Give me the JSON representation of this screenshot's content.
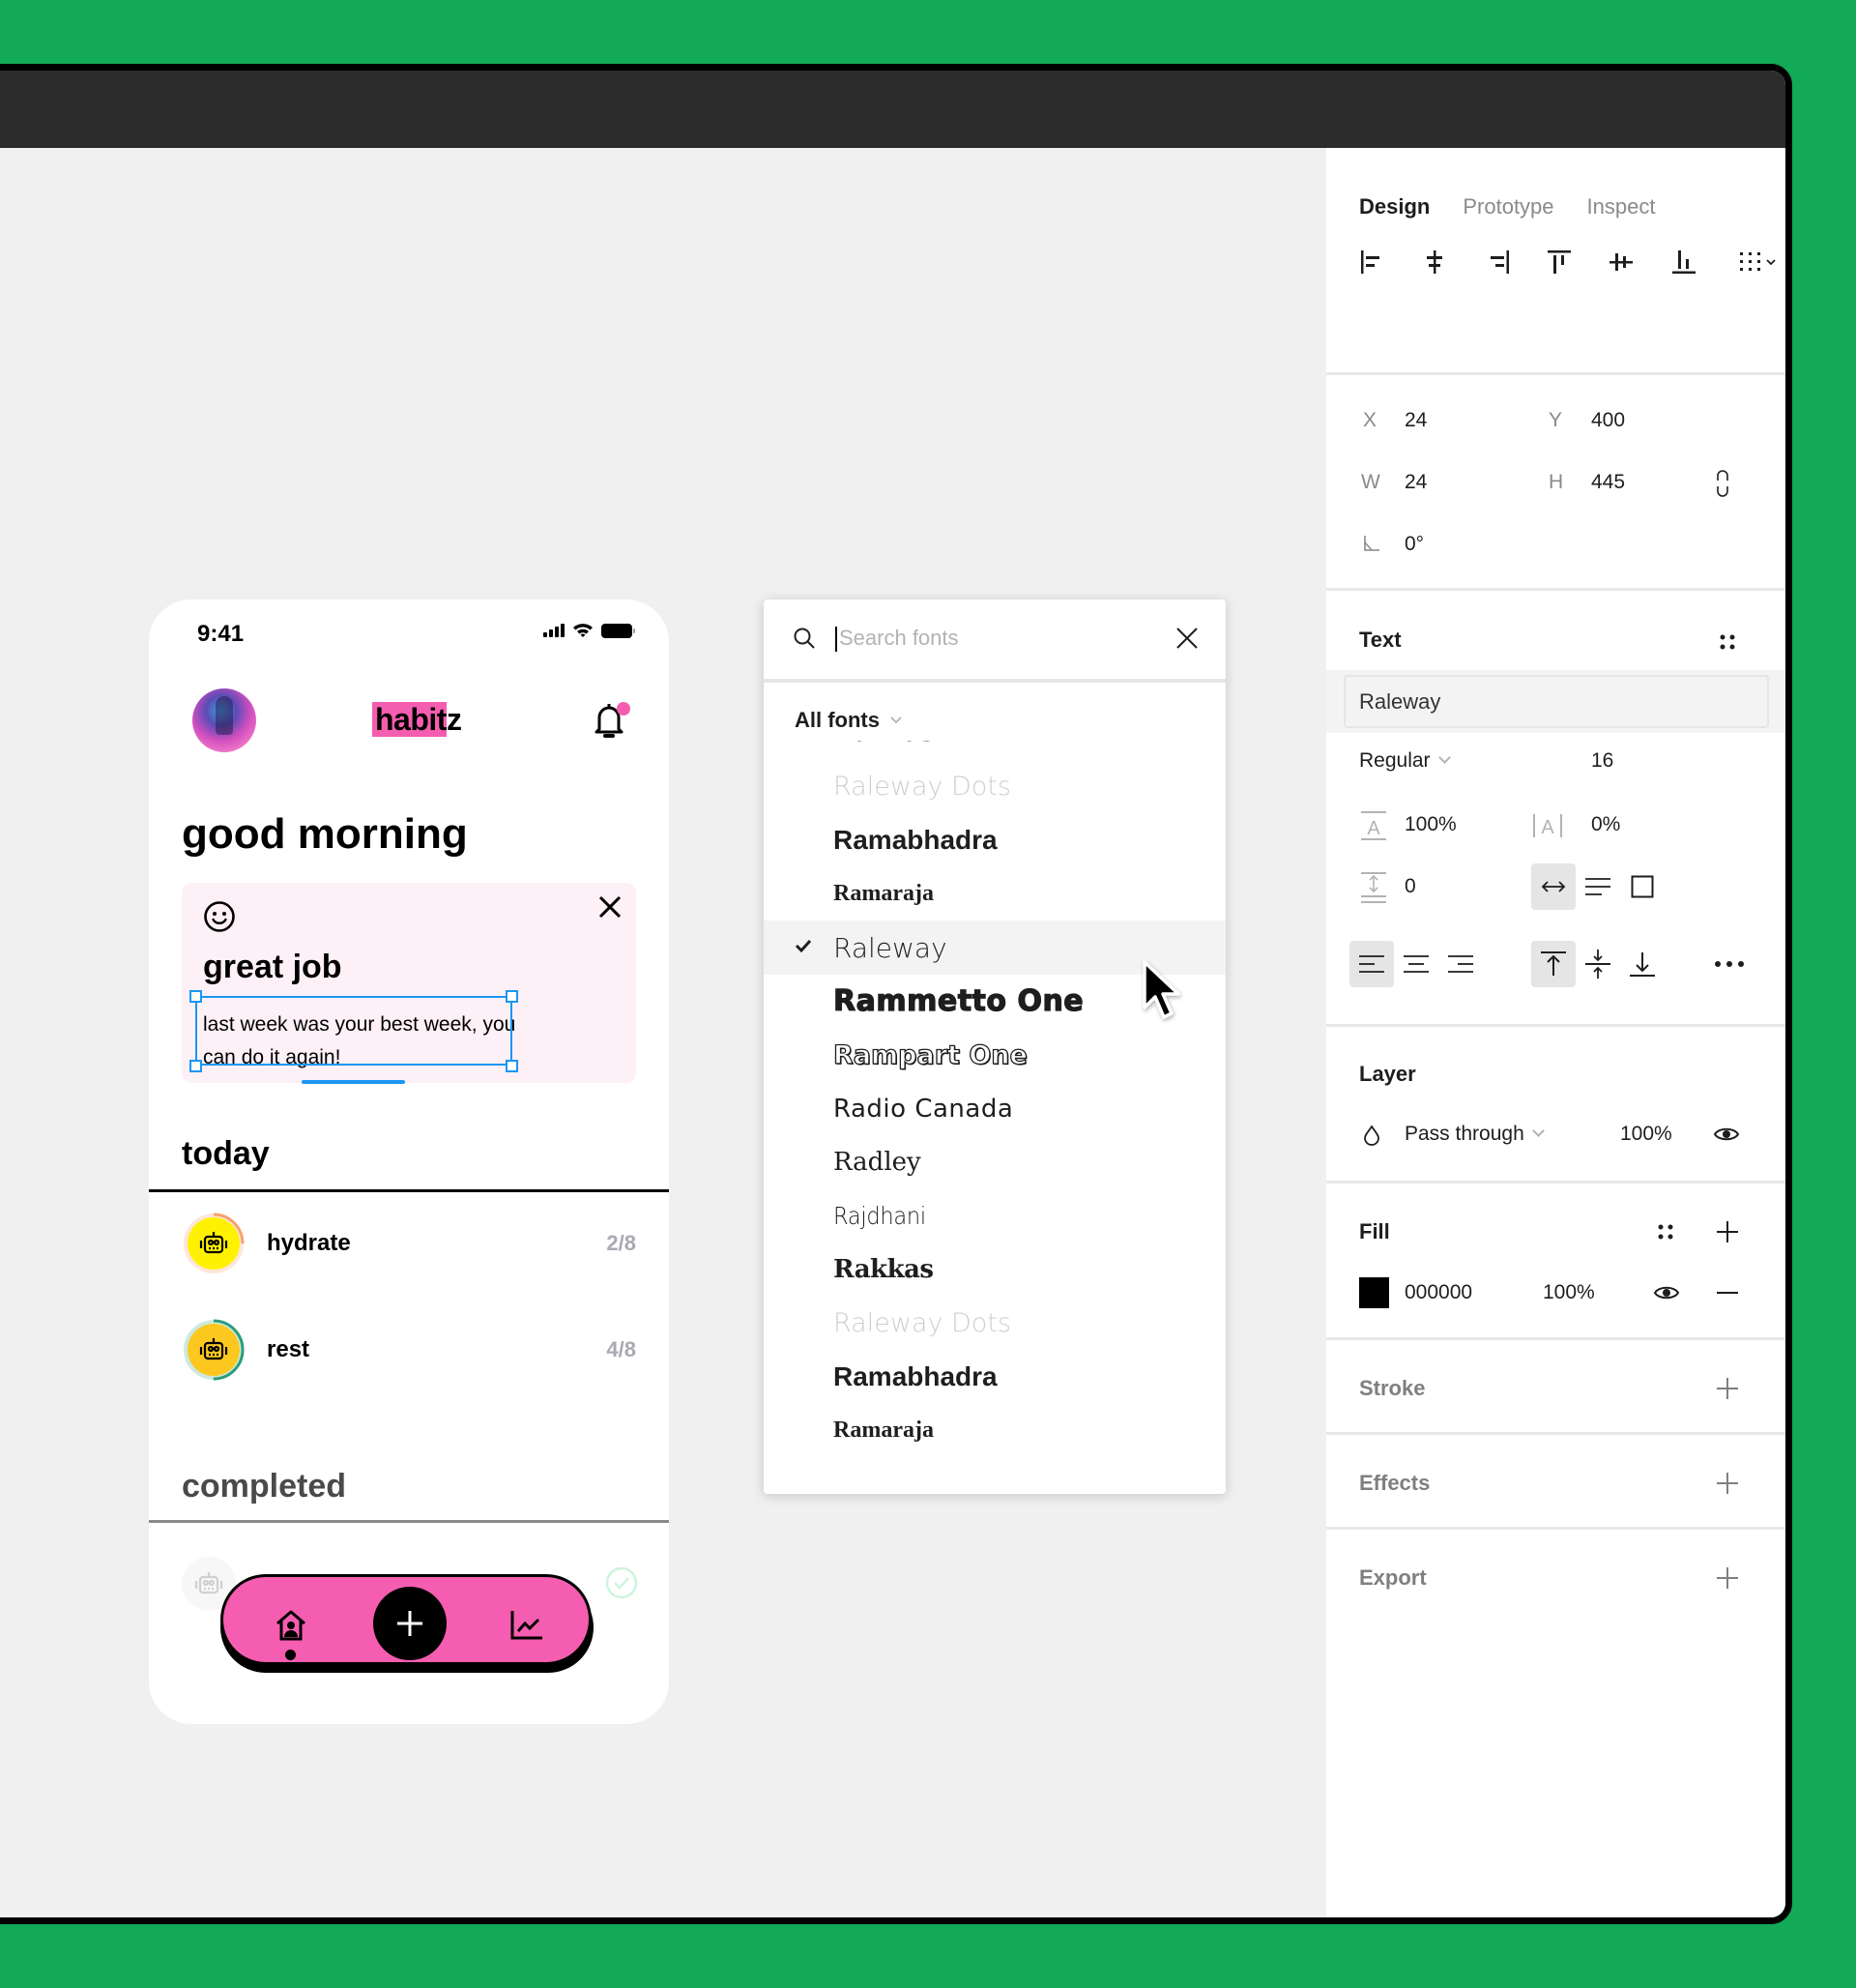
{
  "colors": {
    "background": "#12a957",
    "brand_pink": "#f55db0",
    "selection_blue": "#1b96f3",
    "hydrate_icon": "#fff200",
    "hydrate_ring": "#f7a26b",
    "rest_icon": "#fcc820",
    "rest_ring": "#2a9d7c"
  },
  "phone": {
    "status_time": "9:41",
    "logo_highlight": "habit",
    "logo_rest": "z",
    "greeting": "good morning",
    "card": {
      "title": "great job",
      "message": "last week was your best week, you can do it again!"
    },
    "today_title": "today",
    "habits": [
      {
        "name": "hydrate",
        "count": "2/8",
        "progress": 0.25
      },
      {
        "name": "rest",
        "count": "4/8",
        "progress": 0.5
      }
    ],
    "completed_title": "completed",
    "nav": {
      "home_label": "home",
      "add_label": "add",
      "stats_label": "stats"
    }
  },
  "font_picker": {
    "search_placeholder": "Search fonts",
    "search_value": "",
    "filter_label": "All fonts",
    "fonts": [
      {
        "name": "Rakkas",
        "style": "f-rakkas",
        "selected": false
      },
      {
        "name": "Raleway Dots",
        "style": "f-dots",
        "selected": false
      },
      {
        "name": "Ramabhadra",
        "style": "f-ramabhadra",
        "selected": false
      },
      {
        "name": "Ramaraja",
        "style": "f-ramaraja",
        "selected": false
      },
      {
        "name": "Raleway",
        "style": "f-raleway",
        "selected": true
      },
      {
        "name": "Rammetto One",
        "style": "f-rammetto",
        "selected": false
      },
      {
        "name": "Rampart One",
        "style": "f-rampart",
        "selected": false
      },
      {
        "name": "Radio Canada",
        "style": "f-radio",
        "selected": false
      },
      {
        "name": "Radley",
        "style": "f-radley",
        "selected": false
      },
      {
        "name": "Rajdhani",
        "style": "f-rajdhani",
        "selected": false
      },
      {
        "name": "Rakkas",
        "style": "f-rakkas",
        "selected": false
      },
      {
        "name": "Raleway Dots",
        "style": "f-dots",
        "selected": false
      },
      {
        "name": "Ramabhadra",
        "style": "f-ramabhadra",
        "selected": false
      },
      {
        "name": "Ramaraja",
        "style": "f-ramaraja",
        "selected": false
      }
    ]
  },
  "panel": {
    "tabs": [
      {
        "label": "Design",
        "active": true
      },
      {
        "label": "Prototype",
        "active": false
      },
      {
        "label": "Inspect",
        "active": false
      }
    ],
    "align_tools": [
      "align-left",
      "align-horizontal-center",
      "align-right",
      "align-top",
      "align-vertical-center",
      "align-bottom",
      "distribute"
    ],
    "geometry": {
      "x_label": "X",
      "x": "24",
      "y_label": "Y",
      "y": "400",
      "w_label": "W",
      "w": "24",
      "h_label": "H",
      "h": "445",
      "rotation": "0°"
    },
    "text": {
      "title": "Text",
      "font_family": "Raleway",
      "font_weight": "Regular",
      "font_size": "16",
      "line_height": "100%",
      "letter_spacing": "0%",
      "paragraph_spacing": "0"
    },
    "layer": {
      "title": "Layer",
      "blend_mode": "Pass through",
      "opacity": "100%"
    },
    "fill": {
      "title": "Fill",
      "hex": "000000",
      "swatch": "#000000",
      "opacity": "100%"
    },
    "stroke": {
      "title": "Stroke"
    },
    "effects": {
      "title": "Effects"
    },
    "export": {
      "title": "Export"
    }
  }
}
